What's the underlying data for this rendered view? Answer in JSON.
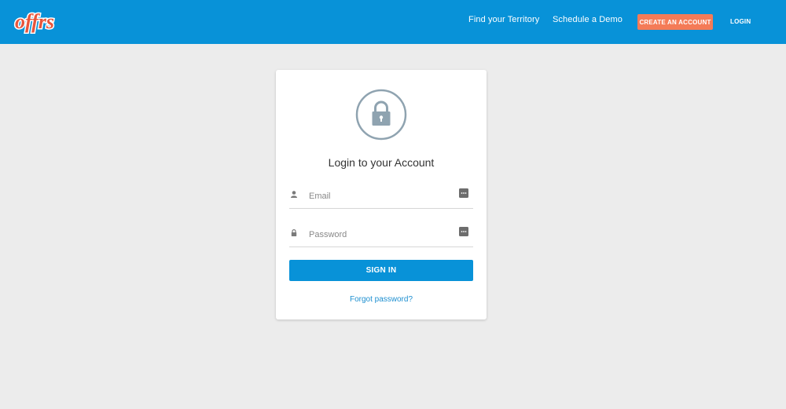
{
  "header": {
    "logo_text": "offrs",
    "nav": {
      "territory": "Find your Territory",
      "demo": "Schedule a Demo",
      "create_account": "CREATE AN ACCOUNT",
      "login": "LOGIN"
    }
  },
  "login_card": {
    "title": "Login to your Account",
    "email_placeholder": "Email",
    "password_placeholder": "Password",
    "sign_in": "SIGN IN",
    "forgot": "Forgot password?"
  },
  "icons": {
    "lock": "lock-icon",
    "user": "user-icon",
    "small_lock": "small-lock-icon",
    "password_manager": "password-manager-icon"
  },
  "colors": {
    "header_bg": "#0892d8",
    "accent_button": "#f47b57",
    "primary_button": "#0892d8",
    "page_bg": "#ececec",
    "link": "#1d8fd0",
    "lock_icon": "#8fa3b0"
  }
}
